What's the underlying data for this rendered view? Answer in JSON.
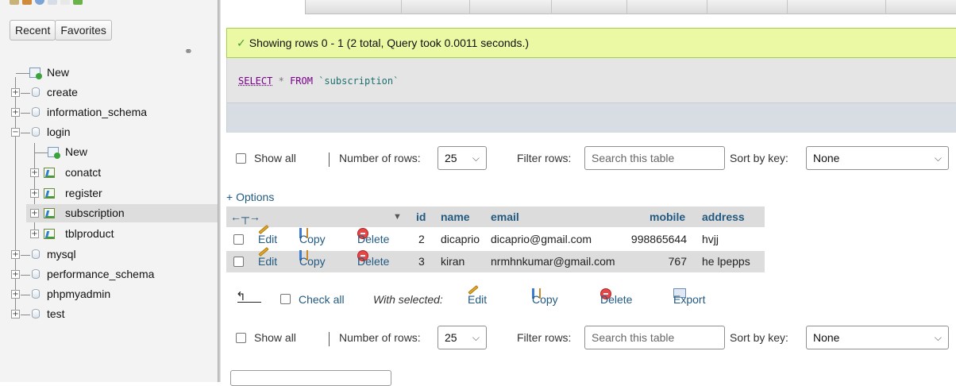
{
  "nav": {
    "tabs": [
      "Recent",
      "Favorites"
    ],
    "tree": [
      {
        "label": "New",
        "kind": "new",
        "level": 0
      },
      {
        "label": "create",
        "kind": "db",
        "level": 0
      },
      {
        "label": "information_schema",
        "kind": "db",
        "level": 0
      },
      {
        "label": "login",
        "kind": "db",
        "level": 0,
        "expanded": true
      },
      {
        "label": "New",
        "kind": "new",
        "level": 1
      },
      {
        "label": "conatct",
        "kind": "table",
        "level": 1
      },
      {
        "label": "register",
        "kind": "table",
        "level": 1
      },
      {
        "label": "subscription",
        "kind": "table",
        "level": 1,
        "selected": true
      },
      {
        "label": "tblproduct",
        "kind": "table",
        "level": 1
      },
      {
        "label": "mysql",
        "kind": "db",
        "level": 0
      },
      {
        "label": "performance_schema",
        "kind": "db",
        "level": 0
      },
      {
        "label": "phpmyadmin",
        "kind": "db",
        "level": 0
      },
      {
        "label": "test",
        "kind": "db",
        "level": 0
      }
    ]
  },
  "message": {
    "success": "Showing rows 0 - 1 (2 total, Query took 0.0011 seconds.)"
  },
  "sql": {
    "select": "SELECT",
    "star": "*",
    "from": "FROM",
    "table": "`subscription`"
  },
  "controls": {
    "show_all": "Show all",
    "number_of_rows_label": "Number of rows:",
    "number_of_rows_value": "25",
    "filter_label": "Filter rows:",
    "filter_placeholder": "Search this table",
    "sort_label": "Sort by key:",
    "sort_value": "None"
  },
  "options_link": "+ Options",
  "table": {
    "columns": [
      "id",
      "name",
      "email",
      "mobile",
      "address"
    ],
    "rows": [
      {
        "id": "2",
        "name": "dicaprio",
        "email": "dicaprio@gmail.com",
        "mobile": "998865644",
        "address": "hvjj"
      },
      {
        "id": "3",
        "name": "kiran",
        "email": "nrmhnkumar@gmail.com",
        "mobile": "767",
        "address": "he lpepps"
      }
    ],
    "actions": {
      "edit": "Edit",
      "copy": "Copy",
      "delete": "Delete"
    }
  },
  "with_selected": {
    "check_all": "Check all",
    "label": "With selected:",
    "edit": "Edit",
    "copy": "Copy",
    "delete": "Delete",
    "export": "Export"
  },
  "colors": {
    "link": "#235a81",
    "success_bg": "#ebf8a4",
    "selected_row": "#dddddd"
  }
}
